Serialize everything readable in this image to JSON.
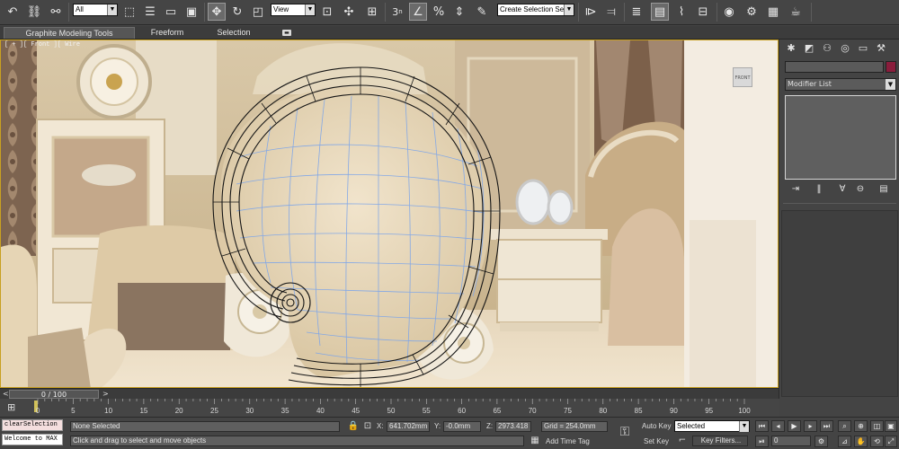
{
  "toolbar": {
    "selection_filter": "All",
    "reference_coord": "View",
    "named_selection": "Create Selection Se",
    "snap_toggle_label": "3",
    "icons": [
      "undo-icon",
      "redo-icon",
      "select-link-icon",
      "unlink-icon",
      "bind-space-warp-icon",
      "select-object-icon",
      "select-by-name-icon",
      "rect-selection-icon",
      "window-crossing-icon",
      "move-icon",
      "rotate-icon",
      "scale-icon",
      "use-pivot-icon",
      "select-manipulate-icon",
      "keyboard-override-icon",
      "snaps-icon",
      "angle-snap-icon",
      "percent-snap-icon",
      "spinner-snap-icon",
      "edit-named-sel-icon",
      "mirror-icon",
      "align-icon",
      "layer-manager-icon",
      "graphite-toggle-icon",
      "curve-editor-icon",
      "schematic-view-icon",
      "material-editor-icon",
      "render-setup-icon",
      "rendered-frame-icon",
      "render-production-icon"
    ]
  },
  "ribbon": {
    "tabs": [
      "Graphite Modeling Tools",
      "Freeform",
      "Selection"
    ],
    "active_tab": "Graphite Modeling Tools"
  },
  "viewport": {
    "label": "[ + ][ Front ][ Wire",
    "viewcube_label": "FRONT"
  },
  "command_panel": {
    "modifier_list": "Modifier List",
    "object_color": "#8a1d3c"
  },
  "timeline": {
    "frame_counter": "0 / 100",
    "ticks": [
      "0",
      "5",
      "10",
      "15",
      "20",
      "25",
      "30",
      "35",
      "40",
      "45",
      "50",
      "55",
      "60",
      "65",
      "70",
      "75",
      "80",
      "85",
      "90",
      "95",
      "100"
    ]
  },
  "status": {
    "maxscript_line1": "clearSelection",
    "maxscript_line2": "Welcome to MAX",
    "selection_info": "None Selected",
    "prompt": "Click and drag to select and move objects",
    "x_label": "X:",
    "x_value": "641.702mm",
    "y_label": "Y:",
    "y_value": "-0.0mm",
    "z_label": "Z:",
    "z_value": "2973.418",
    "grid": "Grid = 254.0mm",
    "add_time_tag": "Add Time Tag",
    "auto_key": "Auto Key",
    "set_key": "Set Key",
    "selected_dropdown": "Selected",
    "key_filters": "Key Filters...",
    "current_frame": "0"
  }
}
